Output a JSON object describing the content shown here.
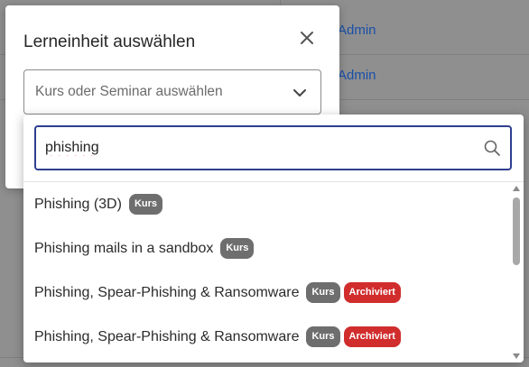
{
  "background": {
    "links": [
      "Admin",
      "Admin"
    ]
  },
  "dialog": {
    "title": "Lerneinheit auswählen",
    "select_placeholder": "Kurs oder Seminar auswählen"
  },
  "dropdown": {
    "search_value": "phishing",
    "items": [
      {
        "label": "Phishing (3D)",
        "badges": [
          "Kurs"
        ]
      },
      {
        "label": "Phishing mails in a sandbox",
        "badges": [
          "Kurs"
        ]
      },
      {
        "label": "Phishing, Spear-Phishing & Ransomware",
        "badges": [
          "Kurs",
          "Archiviert"
        ]
      },
      {
        "label": "Phishing, Spear-Phishing & Ransomware",
        "badges": [
          "Kurs",
          "Archiviert"
        ]
      }
    ]
  },
  "colors": {
    "accent": "#2e3f8f",
    "badge_kurs": "#6e6e6e",
    "badge_archiviert": "#d12d2d",
    "link": "#1a4fa8"
  }
}
